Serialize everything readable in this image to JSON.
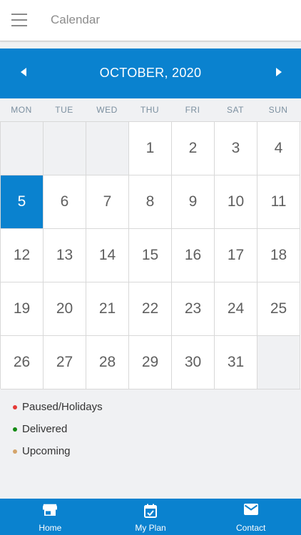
{
  "appbar": {
    "title": "Calendar"
  },
  "calendar": {
    "month_label": "OCTOBER, 2020",
    "weekdays": [
      "MON",
      "TUE",
      "WED",
      "THU",
      "FRI",
      "SAT",
      "SUN"
    ],
    "weeks": [
      [
        "",
        "",
        "",
        "1",
        "2",
        "3",
        "4"
      ],
      [
        "5",
        "6",
        "7",
        "8",
        "9",
        "10",
        "11"
      ],
      [
        "12",
        "13",
        "14",
        "15",
        "16",
        "17",
        "18"
      ],
      [
        "19",
        "20",
        "21",
        "22",
        "23",
        "24",
        "25"
      ],
      [
        "26",
        "27",
        "28",
        "29",
        "30",
        "31",
        ""
      ]
    ],
    "selected_day": "5"
  },
  "legend": [
    {
      "label": "Paused/Holidays",
      "color": "#e53935"
    },
    {
      "label": "Delivered",
      "color": "#138a13"
    },
    {
      "label": "Upcoming",
      "color": "#d4a46a"
    }
  ],
  "bottom_nav": [
    {
      "label": "Home",
      "icon": "store-icon"
    },
    {
      "label": "My Plan",
      "icon": "calendar-icon"
    },
    {
      "label": "Contact",
      "icon": "mail-icon"
    }
  ],
  "colors": {
    "primary": "#0a82cf",
    "background": "#f0f1f3"
  }
}
